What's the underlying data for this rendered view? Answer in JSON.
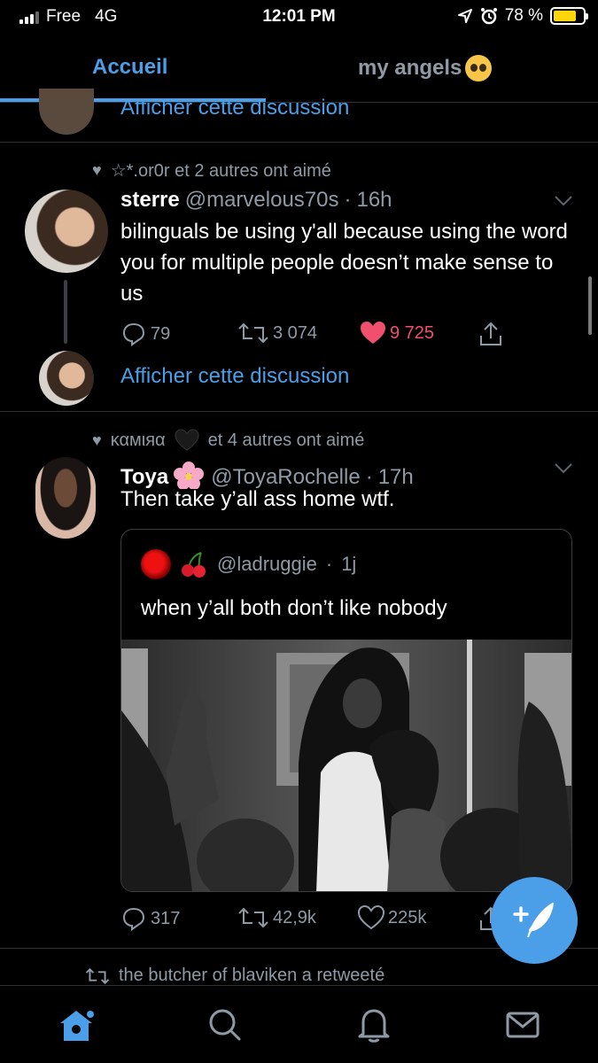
{
  "status_bar": {
    "carrier": "Free",
    "network": "4G",
    "time": "12:01 PM",
    "battery": "78 %",
    "battery_level": 0.78
  },
  "tabs": [
    {
      "label": "Accueil",
      "active": true
    },
    {
      "label": "my angels",
      "active": false,
      "emoji_icon": "pleading-face-icon"
    }
  ],
  "thread_top": {
    "show_thread_label": "Afficher cette discussion"
  },
  "tweet1": {
    "context": "☆*.or0r et 2 autres ont aimé",
    "name": "sterre",
    "handle": "@marvelous70s",
    "dot": "·",
    "time": "16h",
    "text": "bilinguals be using y'all because using the word you for multiple people doesn’t make sense to us",
    "replies": "79",
    "retweets": "3 074",
    "likes": "9 725",
    "liked": true,
    "show_thread_label": "Afficher cette discussion"
  },
  "tweet2": {
    "context_name": "καмιяα",
    "context_rest": "et 4 autres ont aimé",
    "name": "Toya",
    "handle": "@ToyaRochelle",
    "dot": "·",
    "time": "17h",
    "text": "Then take y’all ass home wtf.",
    "quote": {
      "handle": "@ladruggie",
      "dot": "·",
      "time": "1j",
      "text": "when y’all both don’t like nobody"
    },
    "replies": "317",
    "retweets": "42,9k",
    "likes": "225k"
  },
  "next_context": "the butcher of blaviken a retweeté",
  "colors": {
    "accent": "#4a9fe8",
    "like": "#f0506e",
    "muted": "#8e9aa6",
    "background": "#000000"
  }
}
